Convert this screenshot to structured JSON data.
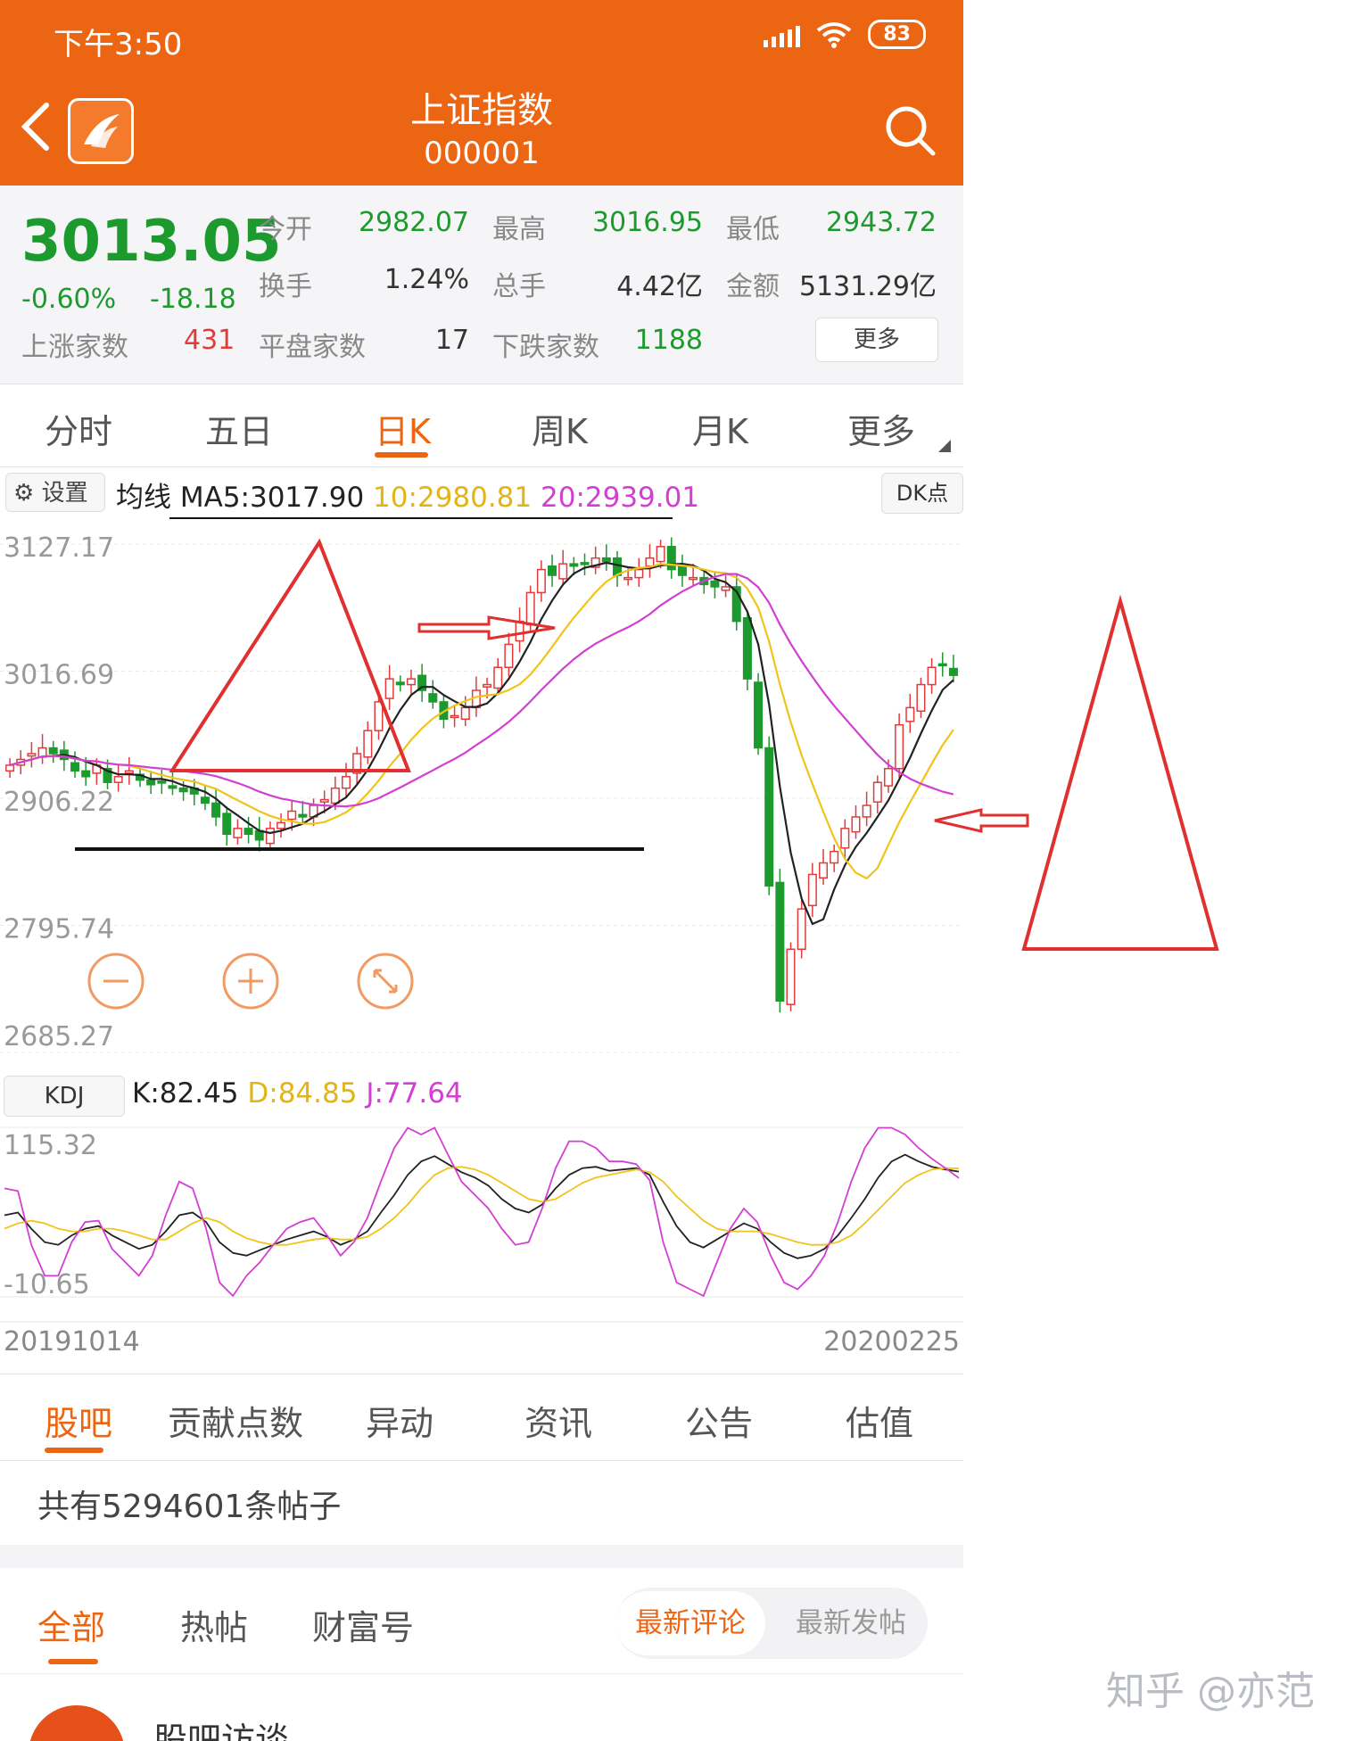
{
  "status_bar": {
    "time": "下午3:50",
    "battery": "83"
  },
  "header": {
    "title": "上证指数",
    "code": "000001"
  },
  "quote": {
    "price": "3013.05",
    "change_pct": "-0.60%",
    "change_abs": "-18.18",
    "open_label": "今开",
    "open": "2982.07",
    "high_label": "最高",
    "high": "3016.95",
    "low_label": "最低",
    "low": "2943.72",
    "turnover_label": "换手",
    "turnover": "1.24%",
    "volume_label": "总手",
    "volume": "4.42亿",
    "amount_label": "金额",
    "amount": "5131.29亿",
    "rise_label": "上涨家数",
    "rise": "431",
    "flat_label": "平盘家数",
    "flat": "17",
    "fall_label": "下跌家数",
    "fall": "1188",
    "more": "更多"
  },
  "period_tabs": [
    "分时",
    "五日",
    "日K",
    "周K",
    "月K",
    "更多"
  ],
  "active_period": "日K",
  "chart": {
    "settings": "设置",
    "ma_label": "均线",
    "ma5": "MA5:3017.90",
    "ma10": "10:2980.81",
    "ma20": "20:2939.01",
    "dk": "DK点",
    "kdj_label": "KDJ",
    "k": "K:82.45",
    "d": "D:84.85",
    "j": "J:77.64",
    "date_start": "20191014",
    "date_end": "20200225",
    "colors": {
      "up": "#e23b3b",
      "down": "#1d9a2e",
      "ma5": "#222222",
      "ma10": "#f0c419",
      "ma20": "#d23fd2"
    }
  },
  "chart_data": [
    {
      "type": "candlestick",
      "title": "",
      "x_range": [
        "20191014",
        "20200225"
      ],
      "y_ticks": [
        3127.17,
        3016.69,
        2906.22,
        2795.74,
        2685.27
      ],
      "ylim": [
        2685.27,
        3127.17
      ],
      "grid": true,
      "series": [
        {
          "name": "MA5",
          "last": 3017.9
        },
        {
          "name": "MA10",
          "last": 2980.81
        },
        {
          "name": "MA20",
          "last": 2939.01
        }
      ],
      "close": [
        2935,
        2940,
        2945,
        2950,
        2945,
        2940,
        2930,
        2925,
        2935,
        2920,
        2925,
        2930,
        2922,
        2918,
        2920,
        2915,
        2912,
        2910,
        2902,
        2890,
        2875,
        2880,
        2875,
        2870,
        2880,
        2885,
        2895,
        2890,
        2900,
        2905,
        2915,
        2925,
        2945,
        2965,
        2990,
        3010,
        3005,
        3010,
        3000,
        2990,
        2975,
        2978,
        2985,
        3000,
        3005,
        3020,
        3040,
        3060,
        3085,
        3105,
        3100,
        3110,
        3108,
        3110,
        3115,
        3112,
        3100,
        3098,
        3105,
        3115,
        3125,
        3105,
        3100,
        3098,
        3092,
        3090,
        3090,
        3060,
        3010,
        2950,
        2830,
        2730,
        2775,
        2810,
        2840,
        2850,
        2860,
        2880,
        2890,
        2900,
        2920,
        2932,
        2970,
        2985,
        3005,
        3020,
        3022,
        3013.05
      ],
      "annotations": [
        "triangle",
        "arrow-right",
        "triangle",
        "arrow-left"
      ]
    },
    {
      "type": "line",
      "title": "KDJ",
      "y_ticks": [
        115.32,
        -10.65
      ],
      "ylim": [
        -10.65,
        115.32
      ],
      "series": [
        {
          "name": "K",
          "last": 82.45,
          "values": [
            50,
            52,
            40,
            30,
            28,
            35,
            40,
            42,
            35,
            30,
            25,
            28,
            38,
            50,
            52,
            45,
            30,
            22,
            20,
            24,
            28,
            32,
            35,
            38,
            34,
            28,
            32,
            38,
            52,
            65,
            80,
            90,
            94,
            88,
            82,
            78,
            72,
            62,
            55,
            52,
            58,
            70,
            80,
            85,
            86,
            83,
            84,
            85,
            80,
            60,
            42,
            30,
            26,
            32,
            38,
            44,
            40,
            30,
            22,
            18,
            20,
            25,
            35,
            48,
            62,
            78,
            90,
            95,
            90,
            86,
            84,
            82.45
          ]
        },
        {
          "name": "D",
          "last": 84.85,
          "values": [
            40,
            44,
            46,
            44,
            40,
            38,
            38,
            40,
            40,
            38,
            35,
            32,
            32,
            38,
            44,
            48,
            45,
            38,
            33,
            30,
            28,
            28,
            30,
            32,
            33,
            32,
            32,
            34,
            40,
            48,
            58,
            70,
            80,
            85,
            86,
            84,
            80,
            74,
            68,
            62,
            60,
            62,
            68,
            74,
            78,
            80,
            82,
            84,
            82,
            75,
            64,
            55,
            46,
            40,
            38,
            38,
            38,
            36,
            33,
            30,
            28,
            28,
            30,
            35,
            44,
            54,
            64,
            74,
            80,
            84,
            85,
            84.85
          ]
        },
        {
          "name": "J",
          "last": 77.64,
          "values": [
            70,
            68,
            28,
            5,
            5,
            30,
            45,
            46,
            25,
            15,
            5,
            20,
            50,
            75,
            70,
            40,
            0,
            -10,
            5,
            15,
            28,
            40,
            45,
            48,
            35,
            20,
            30,
            48,
            75,
            100,
            115,
            110,
            115,
            95,
            75,
            65,
            55,
            40,
            28,
            30,
            55,
            85,
            105,
            105,
            100,
            90,
            90,
            88,
            76,
            30,
            0,
            -5,
            -10,
            15,
            40,
            55,
            45,
            20,
            0,
            -5,
            5,
            20,
            45,
            75,
            100,
            115,
            115,
            110,
            100,
            92,
            85,
            77.64
          ]
        }
      ]
    }
  ],
  "bottom_tabs": [
    "股吧",
    "贡献点数",
    "异动",
    "资讯",
    "公告",
    "估值"
  ],
  "active_bottom_tab": "股吧",
  "post_count": "共有5294601条帖子",
  "feed_tabs": [
    "全部",
    "热帖",
    "财富号"
  ],
  "active_feed_tab": "全部",
  "sort_options": [
    "最新评论",
    "最新发帖"
  ],
  "active_sort": "最新评论",
  "first_post_author": "股吧访谈",
  "watermark": "知乎 @亦范"
}
